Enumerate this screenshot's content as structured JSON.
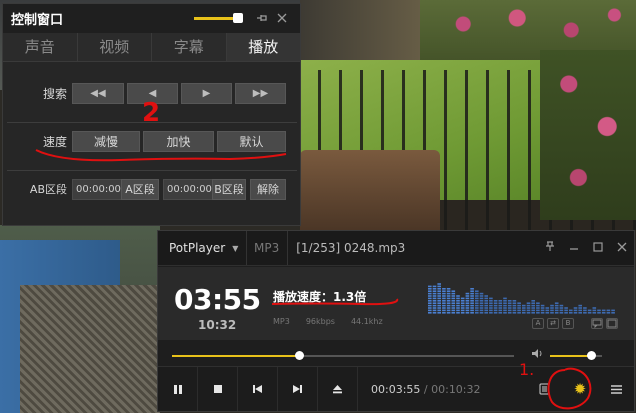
{
  "control_window": {
    "title": "控制窗口",
    "tabs": [
      {
        "label": "声音",
        "active": false
      },
      {
        "label": "视频",
        "active": false
      },
      {
        "label": "字幕",
        "active": false
      },
      {
        "label": "播放",
        "active": true
      }
    ],
    "search": {
      "label": "搜索"
    },
    "speed": {
      "label": "速度",
      "slower": "减慢",
      "faster": "加快",
      "default": "默认"
    },
    "ab_section": {
      "label": "AB区段",
      "start_value": "00:00:00",
      "start_button": "A区段",
      "end_value": "00:00:00",
      "end_button": "B区段",
      "clear": "解除"
    }
  },
  "player": {
    "brand": "PotPlayer",
    "format": "MP3",
    "file": "[1/253] 0248.mp3",
    "current_time": "03:55",
    "total_time": "10:32",
    "speed_text": "播放速度：1.3倍",
    "meta": {
      "codec": "MP3",
      "bitrate": "96kbps",
      "samplerate": "44.1khz"
    },
    "eq_buttons": [
      "A",
      "⇄",
      "B"
    ],
    "seek_fraction": 0.372,
    "volume_fraction": 0.78,
    "time_current": "00:03:55",
    "time_sep": " / ",
    "time_total": "00:10:32"
  },
  "annotations": {
    "number_1": "1.",
    "number_2": "2",
    "color": "#e01010"
  },
  "colors": {
    "accent": "#e8c21a",
    "panel": "#262626"
  }
}
